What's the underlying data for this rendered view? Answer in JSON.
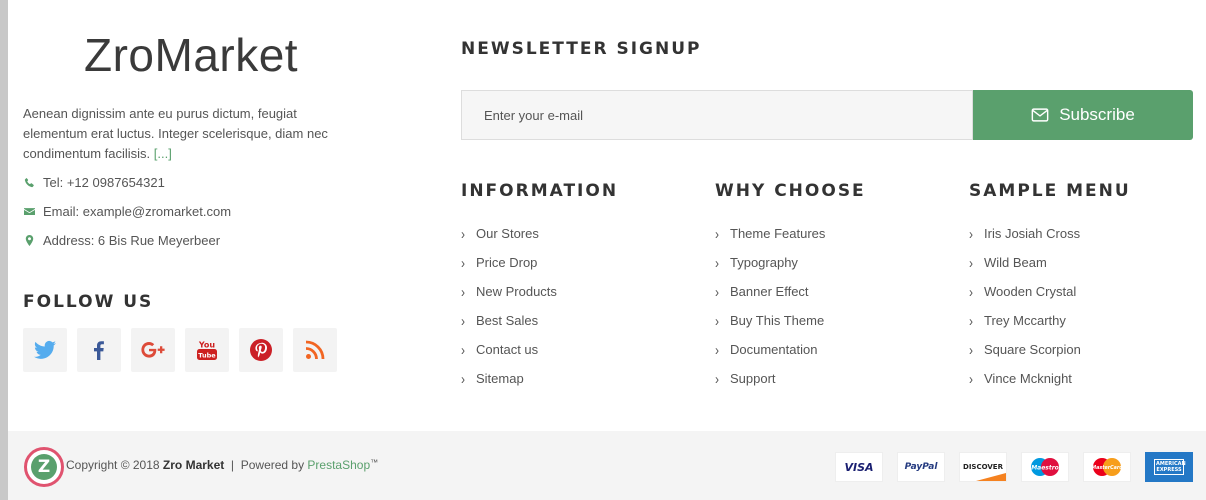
{
  "brand": {
    "logo_text": "ZroMarket"
  },
  "about": {
    "text": "Aenean dignissim ante eu purus dictum, feugiat elementum erat luctus. Integer scelerisque, diam nec condimentum facilisis. ",
    "more_link": "[...]"
  },
  "contact": {
    "tel": "Tel: +12 0987654321",
    "email": "Email: example@zromarket.com",
    "address": "Address: 6 Bis Rue Meyerbeer"
  },
  "follow": {
    "title": "FOLLOW US",
    "icons": [
      "twitter-icon",
      "facebook-icon",
      "google-plus-icon",
      "youtube-icon",
      "pinterest-icon",
      "rss-icon"
    ]
  },
  "newsletter": {
    "title": "NEWSLETTER SIGNUP",
    "placeholder": "Enter your e-mail",
    "button_label": "Subscribe"
  },
  "columns": [
    {
      "title": "INFORMATION",
      "items": [
        "Our Stores",
        "Price Drop",
        "New Products",
        "Best Sales",
        "Contact us",
        "Sitemap"
      ]
    },
    {
      "title": "WHY CHOOSE",
      "items": [
        "Theme Features",
        "Typography",
        "Banner Effect",
        "Buy This Theme",
        "Documentation",
        "Support"
      ]
    },
    {
      "title": "SAMPLE MENU",
      "items": [
        "Iris Josiah Cross",
        "Wild Beam",
        "Wooden Crystal",
        "Trey Mccarthy",
        "Square Scorpion",
        "Vince Mcknight"
      ]
    }
  ],
  "footer": {
    "logo_letter": "Z",
    "copyright_prefix": "Copyright © 2018 ",
    "company": "Zro Market",
    "separator": "  |  Powered by ",
    "platform": "PrestaShop",
    "trademark": "™"
  },
  "payments": [
    "VISA",
    "PayPal",
    "DISCOVER",
    "Maestro",
    "MasterCard",
    "AMERICAN EXPRESS"
  ],
  "colors": {
    "accent": "#5aa06d",
    "logo_ring": "#e0536f",
    "heading": "#333333",
    "text": "#555555"
  }
}
